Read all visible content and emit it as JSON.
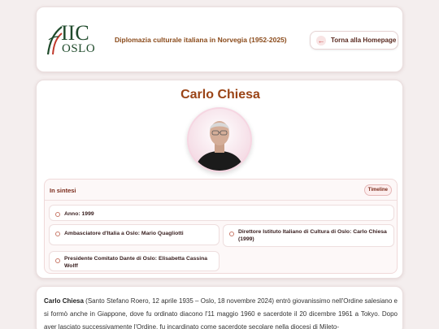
{
  "header": {
    "logo": {
      "text_iic": "IIC",
      "text_oslo": "OSLO",
      "colors": {
        "green": "#1f4a2b",
        "red": "#c0392b"
      }
    },
    "title": "Diplomazia culturale italiana in Norvegia (1952-2025)",
    "home_button": {
      "icon": "arrow-left-icon",
      "label": "Torna alla Homepage"
    }
  },
  "person": {
    "name": "Carlo Chiesa",
    "photo_alt": "Carlo Chiesa"
  },
  "summary": {
    "title": "In sintesi",
    "badge": "Timeline",
    "items": [
      {
        "text": "Anno: 1999"
      },
      {
        "text": "Ambasciatore d'Italia a Oslo: Mario Quagliotti"
      },
      {
        "text": "Direttore Istituto Italiano di Cultura di Oslo: Carlo Chiesa (1999)"
      },
      {
        "text": "Presidente Comitato Dante di Oslo: Elisabetta Cassina Wolff"
      }
    ]
  },
  "bio": {
    "name": "Carlo Chiesa",
    "text": " (Santo Stefano Roero, 12 aprile 1935 – Oslo, 18 novembre 2024) entrò giovanissimo nell'Ordine salesiano e si formò anche in Giappone, dove fu ordinato diacono l'11 maggio 1960 e sacerdote il 20 dicembre 1961 a Tokyo. Dopo aver lasciato successivamente l'Ordine, fu incardinato come sacerdote secolare nella diocesi di Mileto-"
  },
  "colors": {
    "accent": "#9a4416",
    "page_bg": "#f4eeee"
  }
}
